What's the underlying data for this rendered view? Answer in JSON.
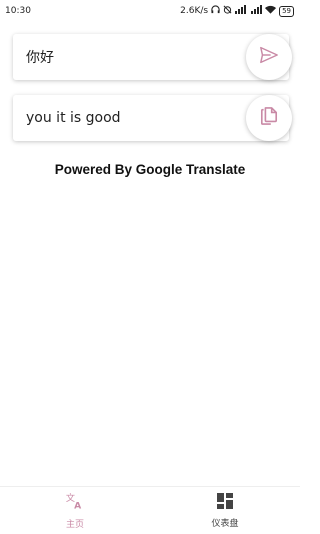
{
  "status_bar": {
    "time": "10:30",
    "net_speed": "2.6K/s",
    "battery": "59",
    "icons": [
      "headphones-icon",
      "alarm-off-icon",
      "signal-icon",
      "hd-signal-icon",
      "wifi-icon",
      "battery-icon"
    ]
  },
  "input": {
    "value": "你好",
    "action_icon": "send-icon"
  },
  "output": {
    "text": "you it is good",
    "action_icon": "copy-icon"
  },
  "footer_text": "Powered By Google Translate",
  "bottom_nav": {
    "items": [
      {
        "label": "主页",
        "icon": "translate-icon",
        "active": true
      },
      {
        "label": "仪表盘",
        "icon": "dashboard-icon",
        "active": false
      }
    ]
  },
  "colors": {
    "accent": "#c98aa6",
    "text": "#222222",
    "inactive_icon": "#444444"
  }
}
